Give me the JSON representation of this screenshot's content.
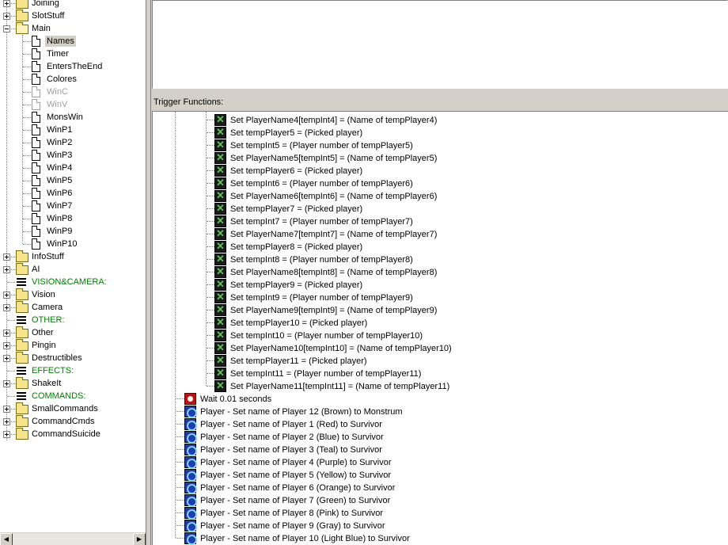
{
  "tree": {
    "items": [
      {
        "label": "Joining",
        "type": "folder",
        "expander": "plus"
      },
      {
        "label": "SlotStuff",
        "type": "folder",
        "expander": "plus"
      },
      {
        "label": "Main",
        "type": "folder-open",
        "expander": "minus"
      },
      {
        "label": "Names",
        "type": "trigger",
        "selected": true
      },
      {
        "label": "Timer",
        "type": "trigger"
      },
      {
        "label": "EntersTheEnd",
        "type": "trigger"
      },
      {
        "label": "Colores",
        "type": "trigger"
      },
      {
        "label": "WinC",
        "type": "trigger",
        "disabled": true
      },
      {
        "label": "WinV",
        "type": "trigger",
        "disabled": true
      },
      {
        "label": "MonsWin",
        "type": "trigger"
      },
      {
        "label": "WinP1",
        "type": "trigger"
      },
      {
        "label": "WinP2",
        "type": "trigger"
      },
      {
        "label": "WinP3",
        "type": "trigger"
      },
      {
        "label": "WinP4",
        "type": "trigger"
      },
      {
        "label": "WinP5",
        "type": "trigger"
      },
      {
        "label": "WinP6",
        "type": "trigger"
      },
      {
        "label": "WinP7",
        "type": "trigger"
      },
      {
        "label": "WinP8",
        "type": "trigger"
      },
      {
        "label": "WinP9",
        "type": "trigger"
      },
      {
        "label": "WinP10",
        "type": "trigger"
      },
      {
        "label": "InfoStuff",
        "type": "folder",
        "expander": "plus"
      },
      {
        "label": "AI",
        "type": "folder",
        "expander": "plus"
      },
      {
        "label": "VISION&CAMERA:",
        "type": "category"
      },
      {
        "label": "Vision",
        "type": "folder",
        "expander": "plus"
      },
      {
        "label": "Camera",
        "type": "folder",
        "expander": "plus"
      },
      {
        "label": "OTHER:",
        "type": "category"
      },
      {
        "label": "Other",
        "type": "folder",
        "expander": "plus"
      },
      {
        "label": "Pingin",
        "type": "folder",
        "expander": "plus"
      },
      {
        "label": "Destructibles",
        "type": "folder",
        "expander": "plus"
      },
      {
        "label": "EFFECTS:",
        "type": "category"
      },
      {
        "label": "ShakeIt",
        "type": "folder",
        "expander": "plus"
      },
      {
        "label": "COMMANDS:",
        "type": "category"
      },
      {
        "label": "SmallCommands",
        "type": "folder",
        "expander": "plus"
      },
      {
        "label": "CommandCmds",
        "type": "folder",
        "expander": "plus"
      },
      {
        "label": "CommandSuicide",
        "type": "folder",
        "expander": "plus"
      }
    ]
  },
  "scrollbar": {
    "left_arrow": "◀",
    "right_arrow": "▶"
  },
  "functions_header": "Trigger Functions:",
  "functions": [
    {
      "text": "Set PlayerName4[tempInt4] = (Name of tempPlayer4)",
      "icon": "set",
      "level": 2
    },
    {
      "text": "Set tempPlayer5 = (Picked player)",
      "icon": "set",
      "level": 2
    },
    {
      "text": "Set tempInt5 = (Player number of tempPlayer5)",
      "icon": "set",
      "level": 2
    },
    {
      "text": "Set PlayerName5[tempInt5] = (Name of tempPlayer5)",
      "icon": "set",
      "level": 2
    },
    {
      "text": "Set tempPlayer6 = (Picked player)",
      "icon": "set",
      "level": 2
    },
    {
      "text": "Set tempInt6 = (Player number of tempPlayer6)",
      "icon": "set",
      "level": 2
    },
    {
      "text": "Set PlayerName6[tempInt6] = (Name of tempPlayer6)",
      "icon": "set",
      "level": 2
    },
    {
      "text": "Set tempPlayer7 = (Picked player)",
      "icon": "set",
      "level": 2
    },
    {
      "text": "Set tempInt7 = (Player number of tempPlayer7)",
      "icon": "set",
      "level": 2
    },
    {
      "text": "Set PlayerName7[tempInt7] = (Name of tempPlayer7)",
      "icon": "set",
      "level": 2
    },
    {
      "text": "Set tempPlayer8 = (Picked player)",
      "icon": "set",
      "level": 2
    },
    {
      "text": "Set tempInt8 = (Player number of tempPlayer8)",
      "icon": "set",
      "level": 2
    },
    {
      "text": "Set PlayerName8[tempInt8] = (Name of tempPlayer8)",
      "icon": "set",
      "level": 2
    },
    {
      "text": "Set tempPlayer9 = (Picked player)",
      "icon": "set",
      "level": 2
    },
    {
      "text": "Set tempInt9 = (Player number of tempPlayer9)",
      "icon": "set",
      "level": 2
    },
    {
      "text": "Set PlayerName9[tempInt9] = (Name of tempPlayer9)",
      "icon": "set",
      "level": 2
    },
    {
      "text": "Set tempPlayer10 = (Picked player)",
      "icon": "set",
      "level": 2
    },
    {
      "text": "Set tempInt10 = (Player number of tempPlayer10)",
      "icon": "set",
      "level": 2
    },
    {
      "text": "Set PlayerName10[tempInt10] = (Name of tempPlayer10)",
      "icon": "set",
      "level": 2
    },
    {
      "text": "Set tempPlayer11 = (Picked player)",
      "icon": "set",
      "level": 2
    },
    {
      "text": "Set tempInt11 = (Player number of tempPlayer11)",
      "icon": "set",
      "level": 2
    },
    {
      "text": "Set PlayerName11[tempInt11] = (Name of tempPlayer11)",
      "icon": "set",
      "level": 2
    },
    {
      "text": "Wait 0.01 seconds",
      "icon": "wait",
      "level": 1
    },
    {
      "text": "Player - Set name of Player 12 (Brown) to Monstrum",
      "icon": "player",
      "level": 1
    },
    {
      "text": "Player - Set name of Player 1 (Red) to Survivor",
      "icon": "player",
      "level": 1
    },
    {
      "text": "Player - Set name of Player 2 (Blue) to Survivor",
      "icon": "player",
      "level": 1
    },
    {
      "text": "Player - Set name of Player 3 (Teal) to Survivor",
      "icon": "player",
      "level": 1
    },
    {
      "text": "Player - Set name of Player 4 (Purple) to Survivor",
      "icon": "player",
      "level": 1
    },
    {
      "text": "Player - Set name of Player 5 (Yellow) to Survivor",
      "icon": "player",
      "level": 1
    },
    {
      "text": "Player - Set name of Player 6 (Orange) to Survivor",
      "icon": "player",
      "level": 1
    },
    {
      "text": "Player - Set name of Player 7 (Green) to Survivor",
      "icon": "player",
      "level": 1
    },
    {
      "text": "Player - Set name of Player 8 (Pink) to Survivor",
      "icon": "player",
      "level": 1
    },
    {
      "text": "Player - Set name of Player 9 (Gray) to Survivor",
      "icon": "player",
      "level": 1
    },
    {
      "text": "Player - Set name of Player 10 (Light Blue) to Survivor",
      "icon": "player",
      "level": 1
    }
  ],
  "colors": {
    "category_text": "#008000",
    "disabled_text": "#a0a0a0",
    "set_icon_mark": "#49d142"
  }
}
